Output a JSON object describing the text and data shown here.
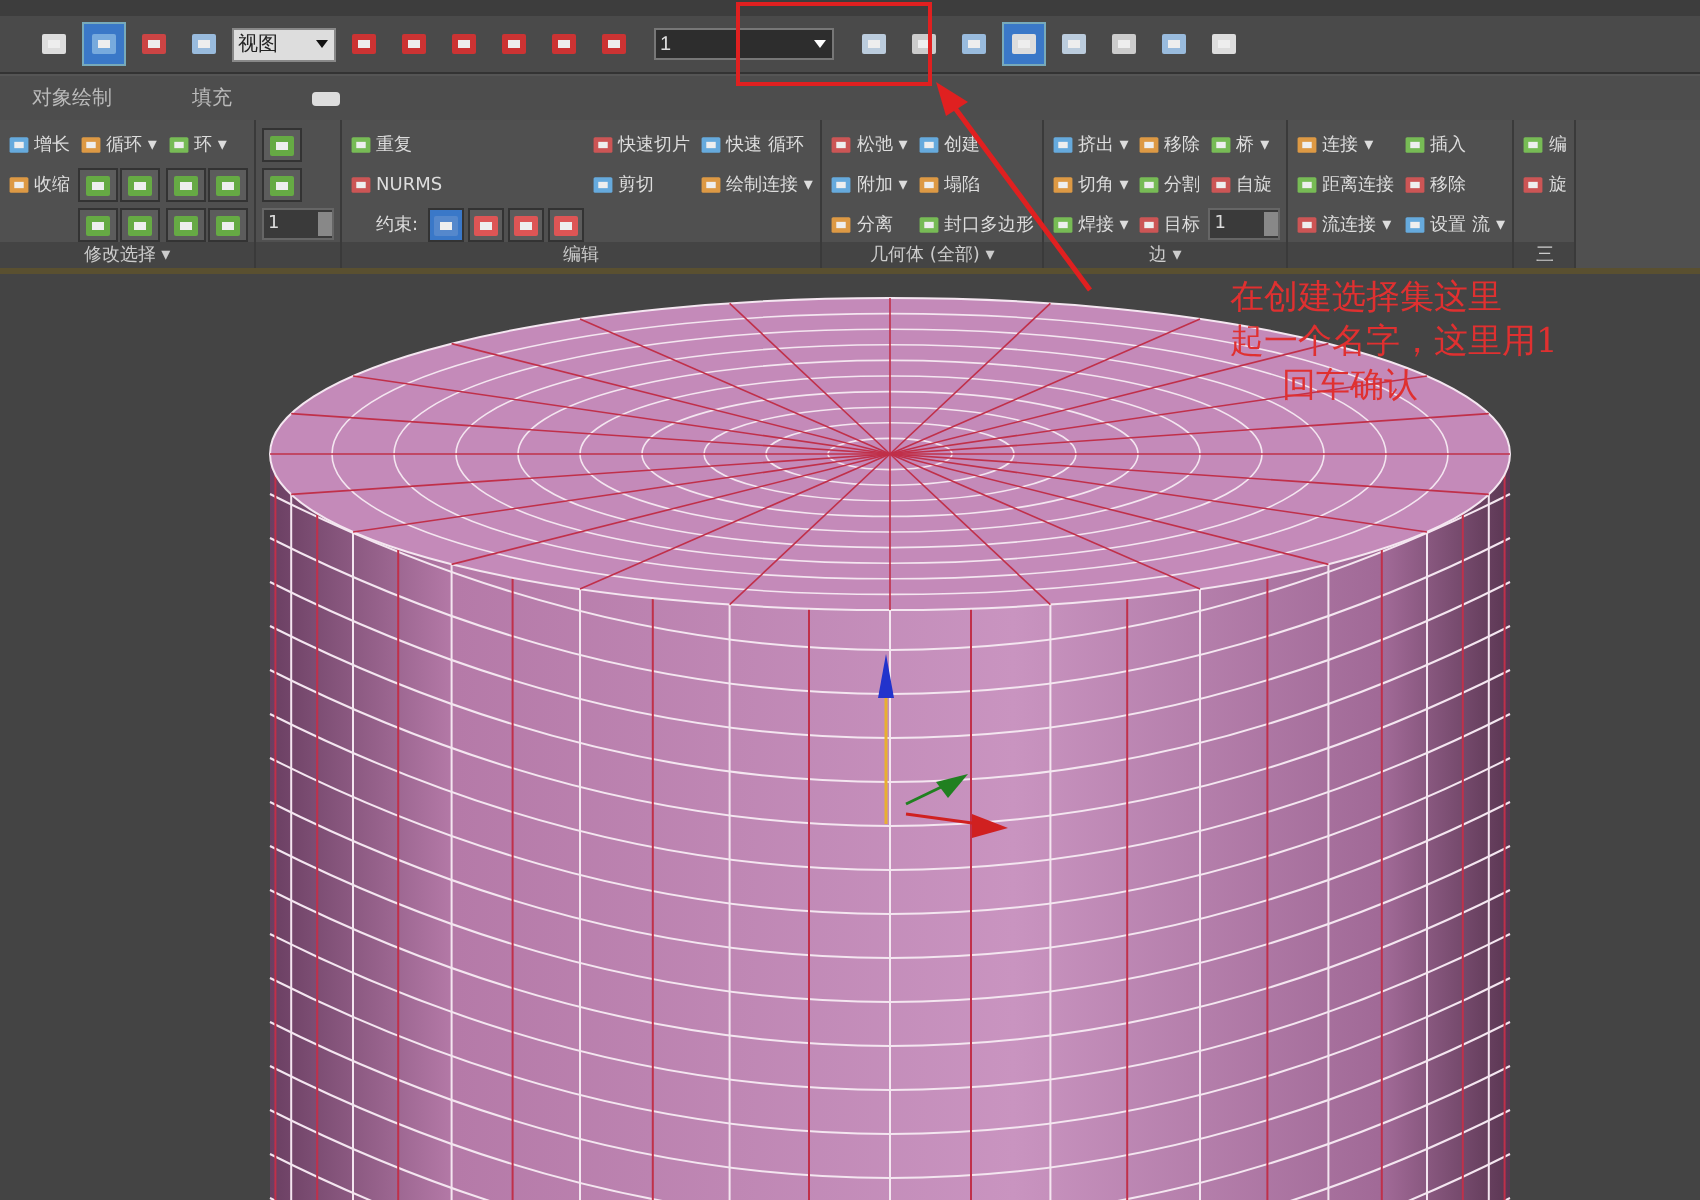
{
  "main_toolbar": {
    "tools_left": [
      {
        "selected": false
      },
      {
        "selected": true
      },
      {
        "selected": false
      },
      {
        "selected": false
      }
    ],
    "view_dropdown": "视图",
    "selection_set_field": {
      "value": "1"
    },
    "tools_right": [
      {
        "selected": false
      },
      {
        "selected": false
      },
      {
        "selected": false
      },
      {
        "selected": true
      },
      {
        "selected": false
      },
      {
        "selected": false
      },
      {
        "selected": false
      },
      {
        "selected": false
      }
    ]
  },
  "ribbon_tabs": [
    {
      "label": "对象绘制"
    },
    {
      "label": "填充"
    }
  ],
  "ribbon_panels": [
    {
      "title": "修改选择 ▾",
      "columns": [
        [
          {
            "kind": "button",
            "label": "增长"
          },
          {
            "kind": "button",
            "label": "收缩"
          }
        ],
        [
          {
            "kind": "button",
            "label": "循环 ▾"
          },
          {
            "kind": "icon_pair"
          },
          {
            "kind": "icon_pair"
          }
        ],
        [
          {
            "kind": "button",
            "label": "环 ▾"
          },
          {
            "kind": "icon_pair"
          },
          {
            "kind": "icon_pair"
          }
        ]
      ]
    },
    {
      "columns": [
        [
          {
            "kind": "icon_single"
          },
          {
            "kind": "icon_single"
          },
          {
            "kind": "spinner",
            "value": "1"
          }
        ]
      ]
    },
    {
      "title": "编辑",
      "columns": [
        [
          {
            "kind": "button",
            "label": "重复"
          },
          {
            "kind": "button",
            "label": "NURMS"
          },
          {
            "kind": "constraint",
            "label": "约束:",
            "options": [
              {
                "selected": true
              },
              {
                "selected": false
              },
              {
                "selected": false
              },
              {
                "selected": false
              }
            ]
          }
        ],
        [
          {
            "kind": "button",
            "label": "快速切片"
          },
          {
            "kind": "button",
            "label": "剪切"
          }
        ],
        [
          {
            "kind": "button",
            "label": "快速 循环"
          },
          {
            "kind": "button",
            "label": "绘制连接 ▾"
          }
        ]
      ]
    },
    {
      "title": "几何体 (全部) ▾",
      "columns": [
        [
          {
            "kind": "button",
            "label": "松弛 ▾"
          },
          {
            "kind": "button",
            "label": "附加 ▾"
          },
          {
            "kind": "button",
            "label": "分离"
          }
        ],
        [
          {
            "kind": "button",
            "label": "创建"
          },
          {
            "kind": "button",
            "label": "塌陷"
          },
          {
            "kind": "button",
            "label": "封口多边形"
          }
        ]
      ]
    },
    {
      "title": "边 ▾",
      "columns": [
        [
          {
            "kind": "button",
            "label": "挤出 ▾"
          },
          {
            "kind": "button",
            "label": "切角 ▾"
          },
          {
            "kind": "button",
            "label": "焊接 ▾"
          }
        ],
        [
          {
            "kind": "button",
            "label": "移除"
          },
          {
            "kind": "button",
            "label": "分割"
          },
          {
            "kind": "button",
            "label": "目标"
          }
        ],
        [
          {
            "kind": "button",
            "label": "桥 ▾"
          },
          {
            "kind": "button",
            "label": "自旋"
          },
          {
            "kind": "spinner",
            "value": "1"
          }
        ]
      ]
    },
    {
      "columns": [
        [
          {
            "kind": "button",
            "label": "连接 ▾"
          },
          {
            "kind": "button",
            "label": "距离连接"
          },
          {
            "kind": "button",
            "label": "流连接 ▾"
          }
        ],
        [
          {
            "kind": "button",
            "label": "插入"
          },
          {
            "kind": "button",
            "label": "移除"
          },
          {
            "kind": "button",
            "label": "设置 流 ▾"
          }
        ]
      ]
    },
    {
      "title": "三",
      "columns": [
        [
          {
            "kind": "button",
            "label": "编"
          },
          {
            "kind": "button",
            "label": "旋"
          }
        ]
      ]
    }
  ],
  "annotation": {
    "lines": [
      "在创建选择集这里",
      "起一个名字，这里用1",
      "回车确认"
    ]
  }
}
